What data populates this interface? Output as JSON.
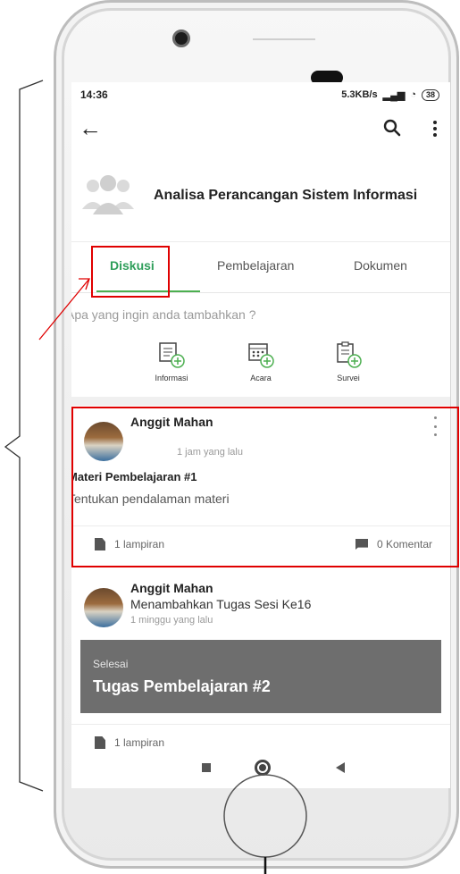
{
  "status_bar": {
    "time": "14:36",
    "network": "5.3KB/s",
    "battery": "38"
  },
  "group": {
    "title": "Analisa Perancangan Sistem Informasi"
  },
  "tabs": [
    {
      "label": "Diskusi"
    },
    {
      "label": "Pembelajaran"
    },
    {
      "label": "Dokumen"
    }
  ],
  "prompt": "Apa yang ingin anda tambahkan ?",
  "actions": [
    {
      "label": "Informasi",
      "icon": "informasi-add-icon"
    },
    {
      "label": "Acara",
      "icon": "calendar-add-icon"
    },
    {
      "label": "Survei",
      "icon": "survey-add-icon"
    }
  ],
  "posts": [
    {
      "author": "Anggit Mahan",
      "time": "1 jam yang lalu",
      "title": "Materi Pembelajaran #1",
      "body": "Tentukan pendalaman materi",
      "attachments": "1 lampiran",
      "comments": "0 Komentar"
    },
    {
      "author": "Anggit Mahan",
      "subtitle": "Menambahkan Tugas Sesi Ke16",
      "time": "1 minggu yang lalu",
      "task_status": "Selesai",
      "task_title": "Tugas Pembelajaran #2",
      "attachments": "1 lampiran"
    }
  ],
  "colors": {
    "accent": "#2e9e5a",
    "annotation": "#e00000",
    "task_card": "#6e6e6e"
  }
}
